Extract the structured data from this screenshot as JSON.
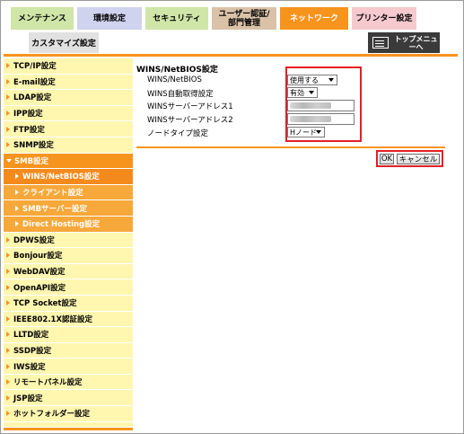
{
  "tabs": {
    "maintenance": "メンテナンス",
    "environment": "環境設定",
    "security": "セキュリティ",
    "user_auth": "ユーザー認証/部門管理",
    "network": "ネットワーク",
    "printer": "プリンター設定"
  },
  "subtab": {
    "customize": "カスタマイズ設定"
  },
  "top_menu": {
    "label": "トップメニューへ",
    "icon": "top-menu-icon"
  },
  "sidebar": {
    "items": [
      {
        "label": "TCP/IP設定"
      },
      {
        "label": "E-mail設定"
      },
      {
        "label": "LDAP設定"
      },
      {
        "label": "IPP設定"
      },
      {
        "label": "FTP設定"
      },
      {
        "label": "SNMP設定"
      },
      {
        "label": "SMB設定"
      },
      {
        "label": "WINS/NetBIOS設定"
      },
      {
        "label": "クライアント設定"
      },
      {
        "label": "SMBサーバー設定"
      },
      {
        "label": "Direct Hosting設定"
      },
      {
        "label": "DPWS設定"
      },
      {
        "label": "Bonjour設定"
      },
      {
        "label": "WebDAV設定"
      },
      {
        "label": "OpenAPI設定"
      },
      {
        "label": "TCP Socket設定"
      },
      {
        "label": "IEEE802.1X認証設定"
      },
      {
        "label": "LLTD設定"
      },
      {
        "label": "SSDP設定"
      },
      {
        "label": "IWS設定"
      },
      {
        "label": "リモートパネル設定"
      },
      {
        "label": "JSP設定"
      },
      {
        "label": "ホットフォルダー設定"
      }
    ]
  },
  "main": {
    "title": "WINS/NetBIOS設定",
    "fields": [
      {
        "label": "WINS/NetBIOS",
        "value": "使用する"
      },
      {
        "label": "WINS自動取得設定",
        "value": "有効"
      },
      {
        "label": "WINSサーバーアドレス1",
        "value": ""
      },
      {
        "label": "WINSサーバーアドレス2",
        "value": ""
      },
      {
        "label": "ノードタイプ設定",
        "value": "Hノード"
      }
    ]
  },
  "buttons": {
    "ok": "OK",
    "cancel": "キャンセル"
  },
  "colors": {
    "accent": "#f7941d",
    "sidebar_bg": "#fff6b0",
    "highlight": "#e41e26"
  }
}
